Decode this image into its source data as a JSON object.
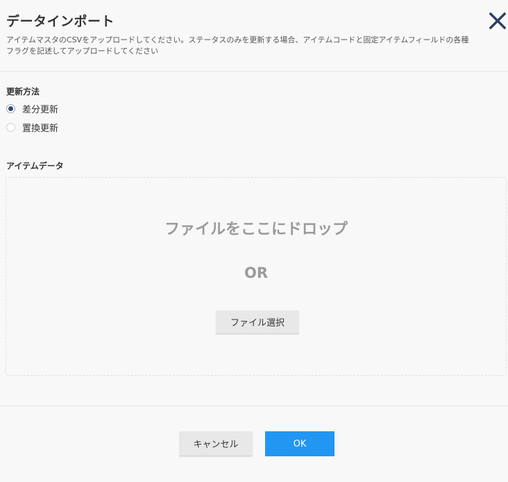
{
  "dialog": {
    "title": "データインポート",
    "description": "アイテムマスタのCSVをアップロードしてください。ステータスのみを更新する場合、アイテムコードと固定アイテムフィールドの各種フラグを記述してアップロードしてください",
    "close_icon": "close-x-icon"
  },
  "update_method": {
    "label": "更新方法",
    "options": [
      {
        "label": "差分更新",
        "checked": true
      },
      {
        "label": "置換更新",
        "checked": false
      }
    ]
  },
  "item_data": {
    "label": "アイテムデータ",
    "drop_text": "ファイルをここにドロップ",
    "or_text": "OR",
    "file_select_label": "ファイル選択"
  },
  "footer": {
    "cancel_label": "キャンセル",
    "ok_label": "OK"
  },
  "colors": {
    "accent": "#2196f3",
    "close_icon": "#2c3e66",
    "radio_checked": "#334a6e"
  }
}
